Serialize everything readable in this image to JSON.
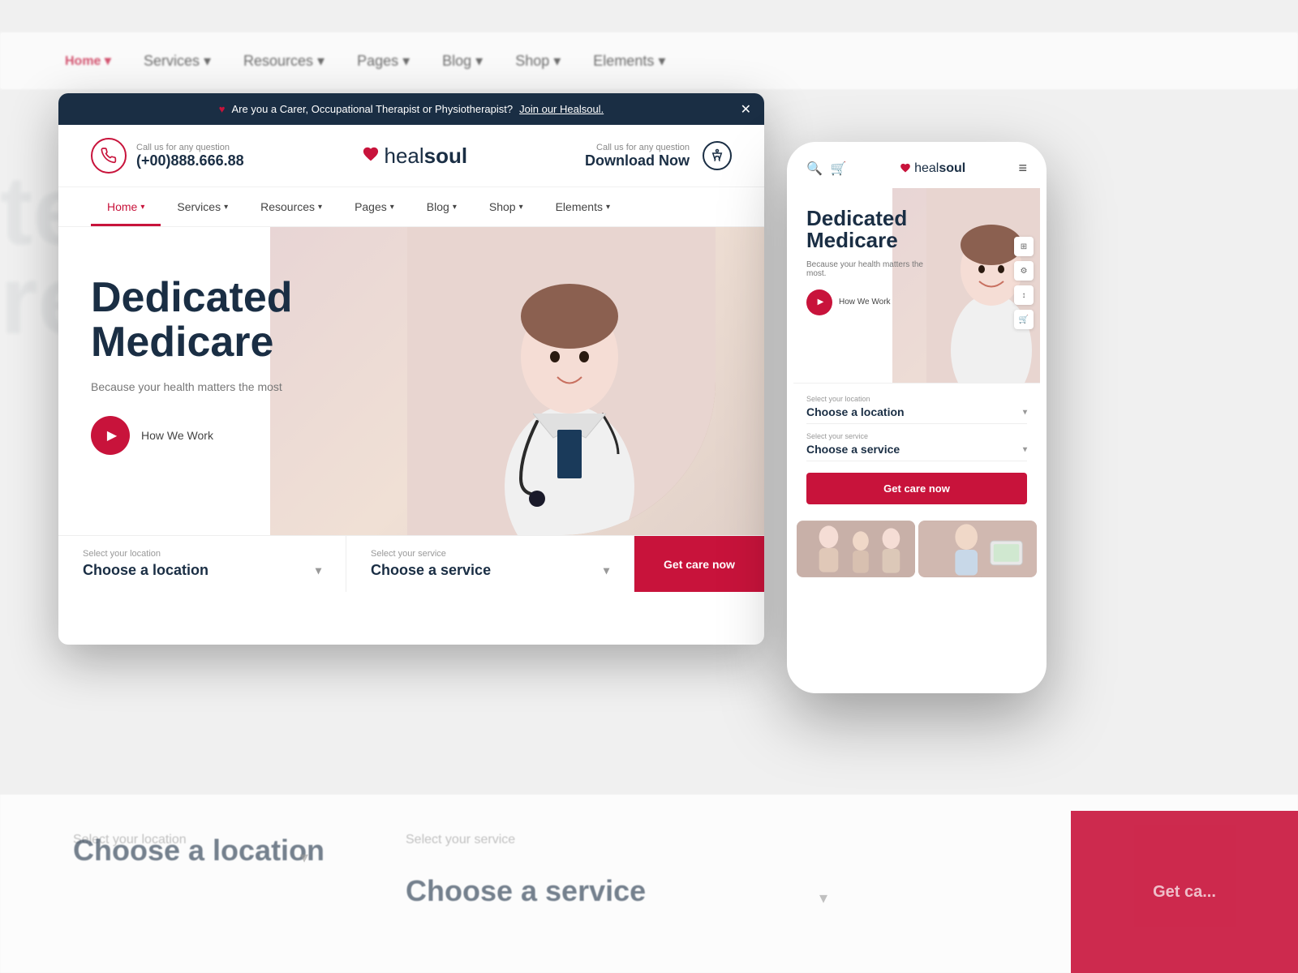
{
  "site": {
    "name": "healsoul",
    "tagline": "heal",
    "tagline2": "soul"
  },
  "announcement": {
    "text": "Are you a Carer, Occupational Therapist or Physiotherapist?",
    "link_text": "Join our Healsoul.",
    "heart": "♥"
  },
  "header": {
    "phone_label": "Call us for any question",
    "phone_number": "(+00)888.666.88",
    "download_label": "Call us for any question",
    "download_btn": "Download Now"
  },
  "nav": {
    "items": [
      {
        "label": "Home",
        "active": true
      },
      {
        "label": "Services",
        "active": false
      },
      {
        "label": "Resources",
        "active": false
      },
      {
        "label": "Pages",
        "active": false
      },
      {
        "label": "Blog",
        "active": false
      },
      {
        "label": "Shop",
        "active": false
      },
      {
        "label": "Elements",
        "active": false
      }
    ]
  },
  "hero": {
    "title_line1": "Dedicated",
    "title_line2": "Medicare",
    "subtitle": "Because your health matters the most",
    "cta_label": "How We Work"
  },
  "location_bar": {
    "location_label": "Select your location",
    "location_placeholder": "Choose a location",
    "service_label": "Select your service",
    "service_placeholder": "Choose a service",
    "cta": "Get care now"
  },
  "mobile": {
    "logo": "healsoul",
    "hero_title1": "Dedicated",
    "hero_title2": "Medicare",
    "hero_sub": "Because your health matters the most.",
    "play_label": "How We Work",
    "location_label": "Select your location",
    "location_placeholder": "Choose a location",
    "service_label": "Select your service",
    "service_placeholder": "Choose a service",
    "get_care": "Get care now"
  },
  "background": {
    "services_text": "Services",
    "choose_location": "Choose a location",
    "choose_service": "Choose a service",
    "select_service_label": "Select your service",
    "select_location_label": "Select your location",
    "get_care": "Get ca..."
  },
  "bg_nav": {
    "items": [
      "Services ▾",
      "Resources ▾",
      "Pages ▾",
      "Blog ▾",
      "Shop ▾",
      "Elements ▾"
    ]
  }
}
